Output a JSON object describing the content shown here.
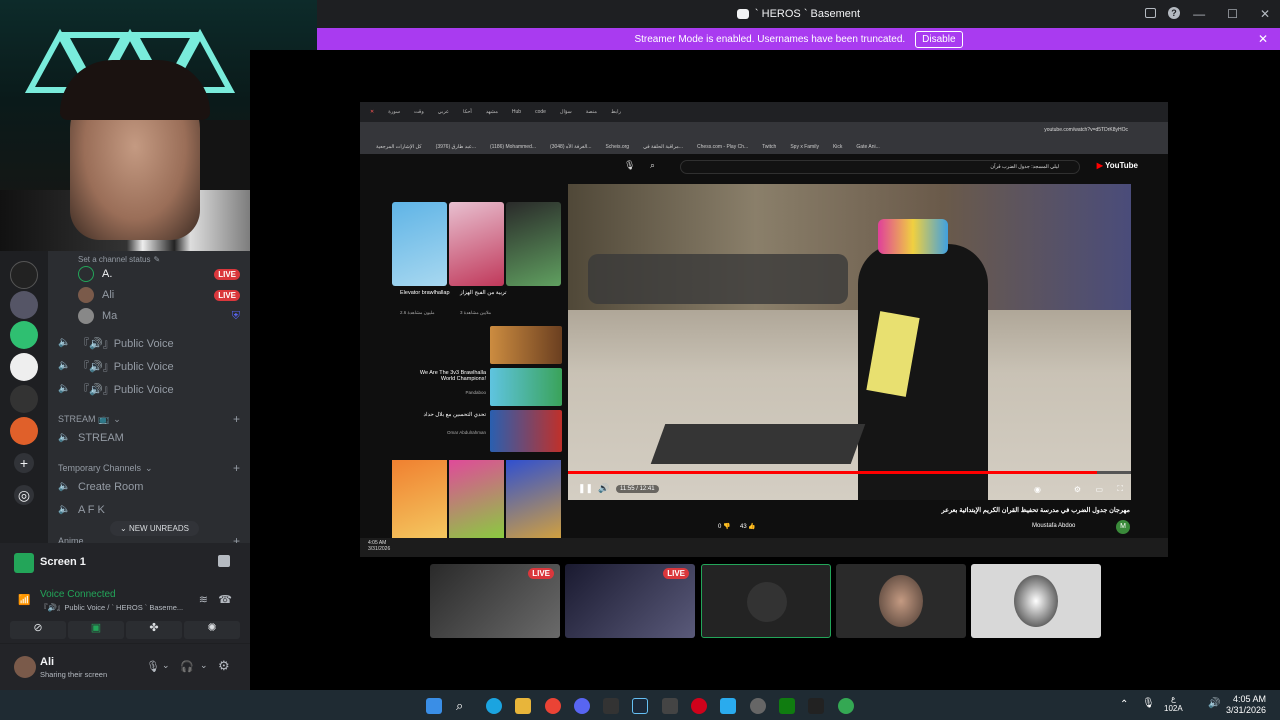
{
  "window": {
    "title": "` HEROS ` Basement"
  },
  "banner": {
    "text": "Streamer Mode is enabled. Usernames have been truncated.",
    "button": "Disable"
  },
  "channels": {
    "status_placeholder": "Set a channel status",
    "voice_members": [
      {
        "name": "A.",
        "live": "LIVE"
      },
      {
        "name": "Ali",
        "live": "LIVE"
      },
      {
        "name": "Ma",
        "live": ""
      }
    ],
    "public_voice": [
      "『🔊』Public Voice",
      "『🔊』Public Voice",
      "『🔊』Public Voice"
    ],
    "stream_category": "STREAM 📺",
    "stream_channel": "STREAM",
    "temp_category": "Temporary Channels",
    "create_room": "Create Room",
    "afk": "A F K",
    "new_unreads": "NEW UNREADS",
    "anime_category": "Anime"
  },
  "share": {
    "title": "Screen 1",
    "voice_status": "Voice Connected",
    "voice_channel": "『🔊』Public Voice / ` HEROS ` Baseme..."
  },
  "user": {
    "name": "Ali",
    "status": "Sharing their screen"
  },
  "shared_screen": {
    "tabs": [
      "سورة",
      "وقت",
      "عربي",
      "أحكا",
      "مشهد",
      "Hub",
      "code",
      "سؤال",
      "منصة",
      "رابط"
    ],
    "address": "youtube.com/watch?v=d5TDrK8yHOc",
    "bookmarks": [
      "كل الإشارات المرجعية",
      "(3976) عبد طارق...",
      "(1186) Mohammed...",
      "(3048) الغرفة الأه...",
      "Scheis.org",
      "مراقبة الحلقة في...",
      "Chess.com - Play Ch...",
      "Twitch",
      "Spy x Family",
      "Kick",
      "Gate Ani..."
    ],
    "search_query": "ليلي المسجد: جدول الضرب قرآن",
    "video_time": "11:55 / 12:41",
    "video_title": "مهرجان جدول الضرب في مدرسة تحفيظ القران الكريم الإبتدائية بعرعر",
    "channel_name": "Moustafa Abdoo",
    "like_count": "43",
    "dislike_count": "0",
    "side_videos": [
      {
        "title": "Elevator brawlhallap",
        "meta": "2.6 مليون مشاهدة"
      },
      {
        "title": "تربية من الفيج الهزاز",
        "meta": "3 ملايين مشاهدة"
      },
      {
        "title": "We Are The 3v3 Brawlhalla World Champions!",
        "meta": "Pandaboo"
      },
      {
        "title": "تحدي التحسين مع بلال حداد",
        "meta": "Omar Abdulrahman"
      }
    ],
    "tb_time": "4:05 AM",
    "tb_date": "3/31/2026"
  },
  "taskbar": {
    "time": "4:05 AM",
    "date": "3/31/2026",
    "lang": "ع",
    "kbd": "102A"
  },
  "colors": {
    "accent": "#a93bf0",
    "live": "#da373c",
    "voice": "#23a559"
  }
}
